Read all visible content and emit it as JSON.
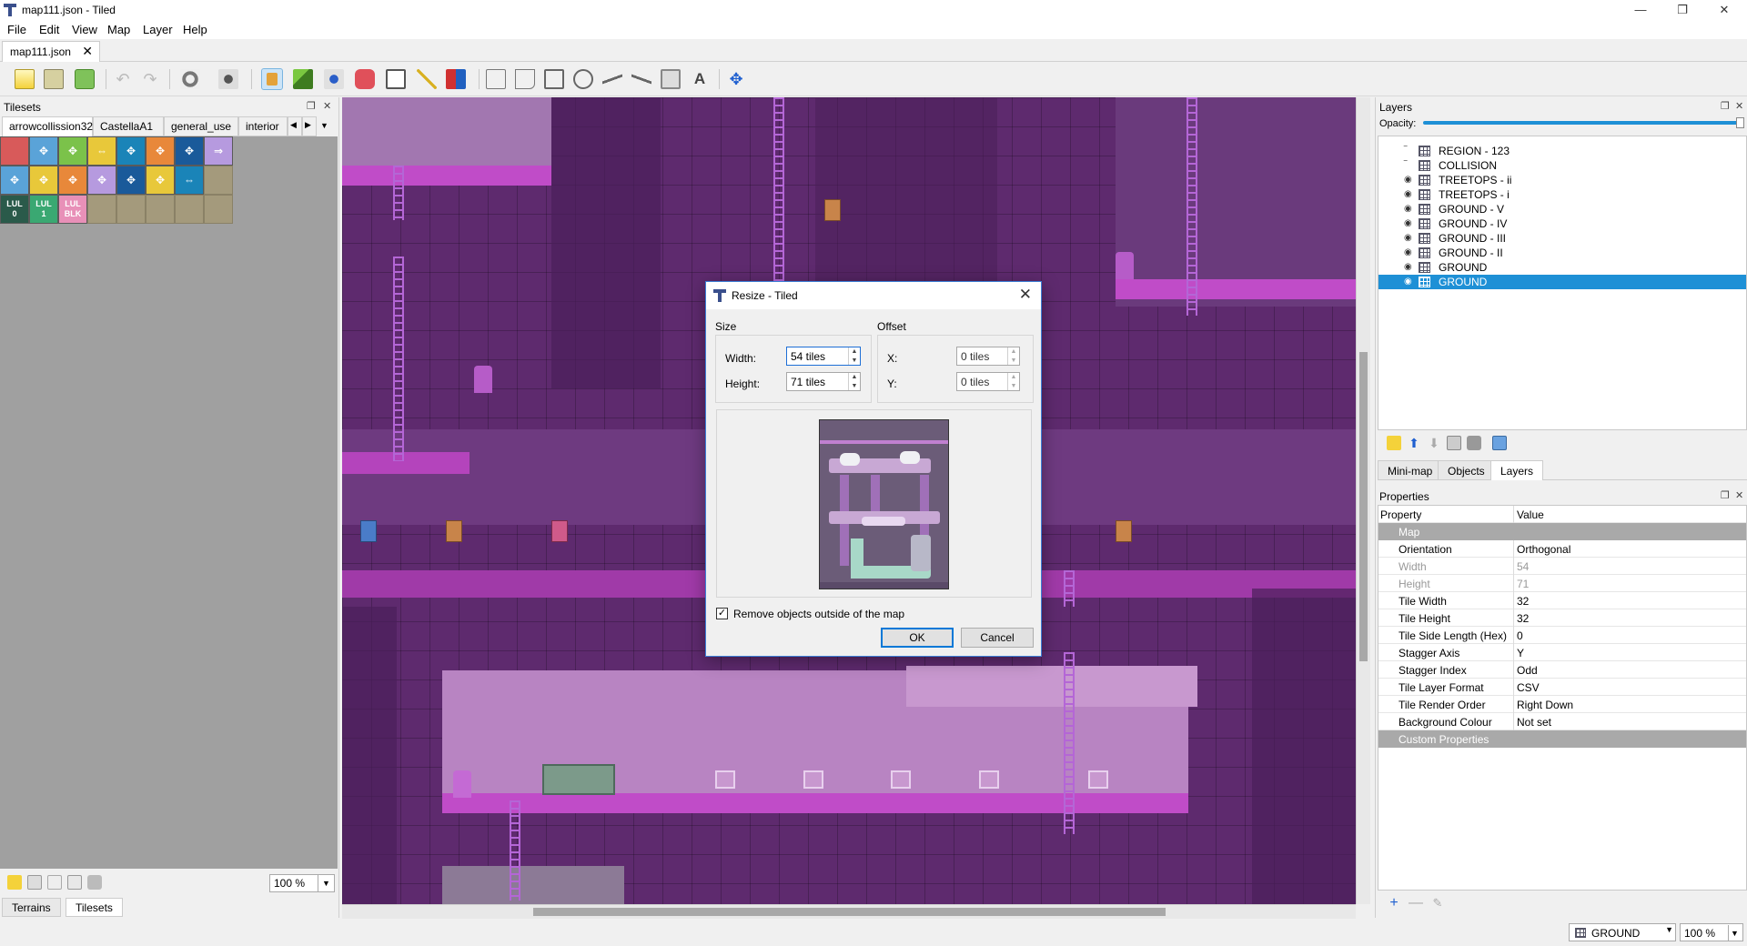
{
  "window": {
    "title": "map111.json - Tiled"
  },
  "menu": [
    "File",
    "Edit",
    "View",
    "Map",
    "Layer",
    "Help"
  ],
  "document_tab": {
    "label": "map111.json"
  },
  "tilesets_panel": {
    "title": "Tilesets",
    "tabs": [
      "arrowcollission32",
      "CastellaA1",
      "general_use",
      "interior"
    ],
    "zoom": "100 %",
    "bottom_tabs": [
      "Terrains",
      "Tilesets"
    ],
    "tile_row3_labels": [
      "LUL\n0",
      "LUL\n1",
      "LUL\nBLK"
    ]
  },
  "layers_panel": {
    "title": "Layers",
    "opacity_label": "Opacity:",
    "layers": [
      {
        "name": "REGION - 123",
        "visible": false
      },
      {
        "name": "COLLISION",
        "visible": false
      },
      {
        "name": "TREETOPS - ii",
        "visible": true
      },
      {
        "name": "TREETOPS - i",
        "visible": true
      },
      {
        "name": "GROUND - V",
        "visible": true
      },
      {
        "name": "GROUND - IV",
        "visible": true
      },
      {
        "name": "GROUND - III",
        "visible": true
      },
      {
        "name": "GROUND - II",
        "visible": true
      },
      {
        "name": "GROUND",
        "visible": true
      },
      {
        "name": "GROUND",
        "visible": true,
        "selected": true
      }
    ],
    "tabs": [
      "Mini-map",
      "Objects",
      "Layers"
    ]
  },
  "properties_panel": {
    "title": "Properties",
    "header": {
      "property": "Property",
      "value": "Value"
    },
    "map_group": "Map",
    "rows": [
      {
        "name": "Orientation",
        "value": "Orthogonal"
      },
      {
        "name": "Width",
        "value": "54",
        "readonly": true
      },
      {
        "name": "Height",
        "value": "71",
        "readonly": true
      },
      {
        "name": "Tile Width",
        "value": "32"
      },
      {
        "name": "Tile Height",
        "value": "32"
      },
      {
        "name": "Tile Side Length (Hex)",
        "value": "0"
      },
      {
        "name": "Stagger Axis",
        "value": "Y"
      },
      {
        "name": "Stagger Index",
        "value": "Odd"
      },
      {
        "name": "Tile Layer Format",
        "value": "CSV"
      },
      {
        "name": "Tile Render Order",
        "value": "Right Down"
      },
      {
        "name": "Background Colour",
        "value": "Not set",
        "expandable": true
      }
    ],
    "custom_group": "Custom Properties"
  },
  "statusbar": {
    "layer": "GROUND",
    "zoom": "100 %"
  },
  "dialog": {
    "title": "Resize - Tiled",
    "size_label": "Size",
    "offset_label": "Offset",
    "width_label": "Width:",
    "width_value": "54 tiles",
    "height_label": "Height:",
    "height_value": "71 tiles",
    "x_label": "X:",
    "x_value": "0 tiles",
    "y_label": "Y:",
    "y_value": "0 tiles",
    "remove_objects_label": "Remove objects outside of the map",
    "remove_objects_checked": true,
    "ok_label": "OK",
    "cancel_label": "Cancel"
  },
  "colors": {
    "accent": "#1e90d6",
    "map_bg": "#5e2a6e",
    "map_floor": "#d79ad9",
    "map_wall": "#7a3d8e"
  }
}
